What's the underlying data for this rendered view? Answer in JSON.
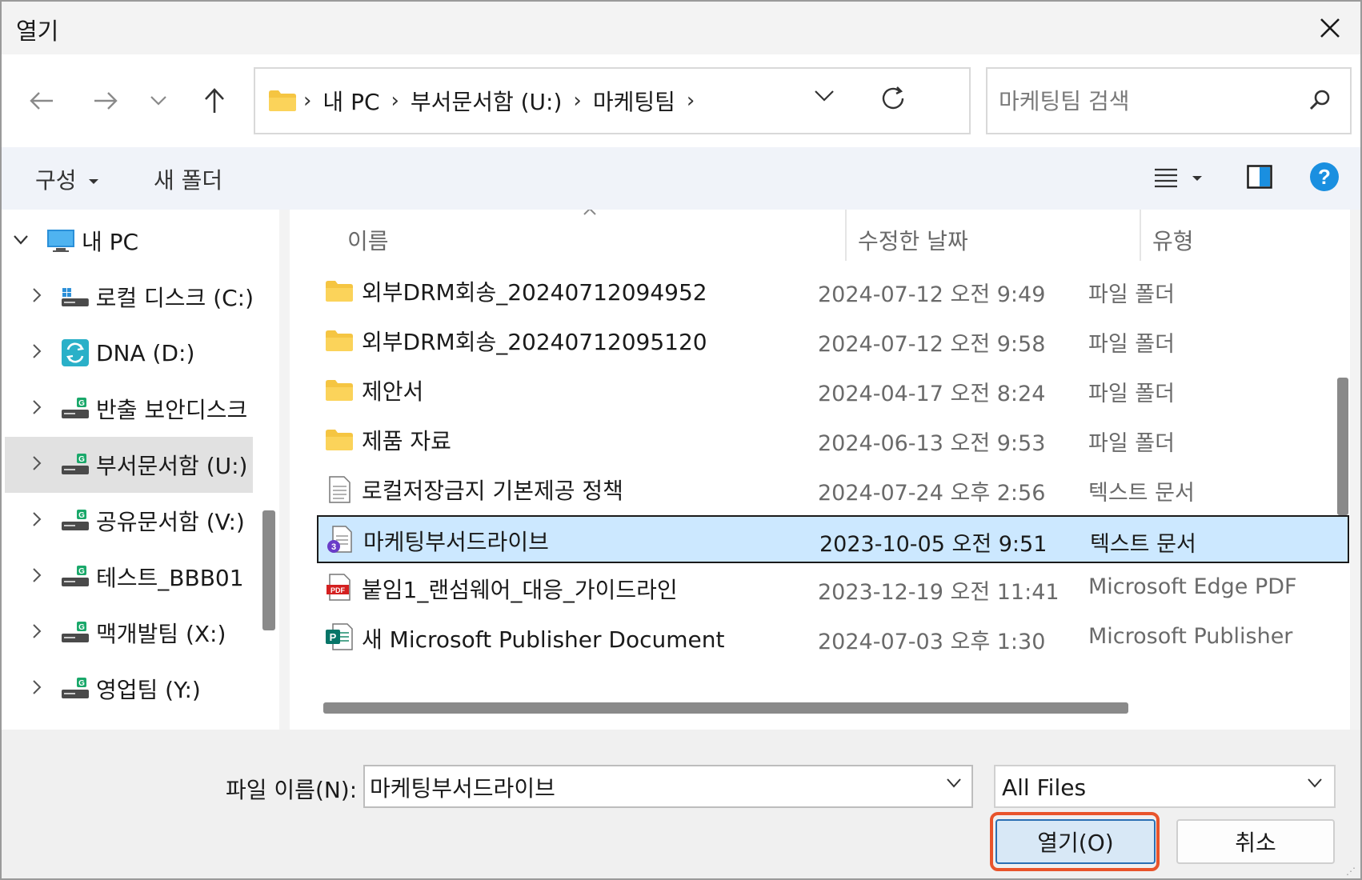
{
  "window": {
    "title": "열기"
  },
  "nav": {
    "breadcrumb": [
      "내 PC",
      "부서문서함 (U:)",
      "마케팅팀"
    ],
    "search_placeholder": "마케팅팀 검색"
  },
  "commands": {
    "organize": "구성",
    "new_folder": "새 폴더"
  },
  "tree": [
    {
      "label": "내 PC",
      "icon": "pc-icon",
      "expanded": true
    },
    {
      "label": "로컬 디스크 (C:)",
      "icon": "local-disk-icon"
    },
    {
      "label": "DNA (D:)",
      "icon": "sync-drive-icon"
    },
    {
      "label": "반출 보안디스크",
      "icon": "network-drive-icon"
    },
    {
      "label": "부서문서함 (U:)",
      "icon": "network-drive-icon",
      "selected": true
    },
    {
      "label": "공유문서함 (V:)",
      "icon": "network-drive-icon"
    },
    {
      "label": "테스트_BBB01",
      "icon": "network-drive-icon"
    },
    {
      "label": "맥개발팀 (X:)",
      "icon": "network-drive-icon"
    },
    {
      "label": "영업팀 (Y:)",
      "icon": "network-drive-icon"
    }
  ],
  "columns": {
    "name": "이름",
    "date": "수정한 날짜",
    "type": "유형"
  },
  "files": [
    {
      "name": "외부DRM회송_20240712094952",
      "date": "2024-07-12 오전 9:49",
      "type": "파일 폴더",
      "icon": "folder-icon"
    },
    {
      "name": "외부DRM회송_20240712095120",
      "date": "2024-07-12 오전 9:58",
      "type": "파일 폴더",
      "icon": "folder-icon"
    },
    {
      "name": "제안서",
      "date": "2024-04-17 오전 8:24",
      "type": "파일 폴더",
      "icon": "folder-icon"
    },
    {
      "name": "제품 자료",
      "date": "2024-06-13 오전 9:53",
      "type": "파일 폴더",
      "icon": "folder-icon"
    },
    {
      "name": "로컬저장금지 기본제공 정책",
      "date": "2024-07-24 오후 2:56",
      "type": "텍스트 문서",
      "icon": "text-file-icon"
    },
    {
      "name": "마케팅부서드라이브",
      "date": "2023-10-05 오전 9:51",
      "type": "텍스트 문서",
      "icon": "drm-text-file-icon",
      "selected": true
    },
    {
      "name": "붙임1_랜섬웨어_대응_가이드라인",
      "date": "2023-12-19 오전 11:41",
      "type": "Microsoft Edge PDF",
      "icon": "pdf-icon"
    },
    {
      "name": "새 Microsoft Publisher Document",
      "date": "2024-07-03 오후 1:30",
      "type": "Microsoft Publisher",
      "icon": "publisher-icon"
    }
  ],
  "footer": {
    "filename_label": "파일 이름(N):",
    "filename_value": "마케팅부서드라이브",
    "filter_value": "All Files",
    "open_label": "열기(O)",
    "cancel_label": "취소"
  }
}
